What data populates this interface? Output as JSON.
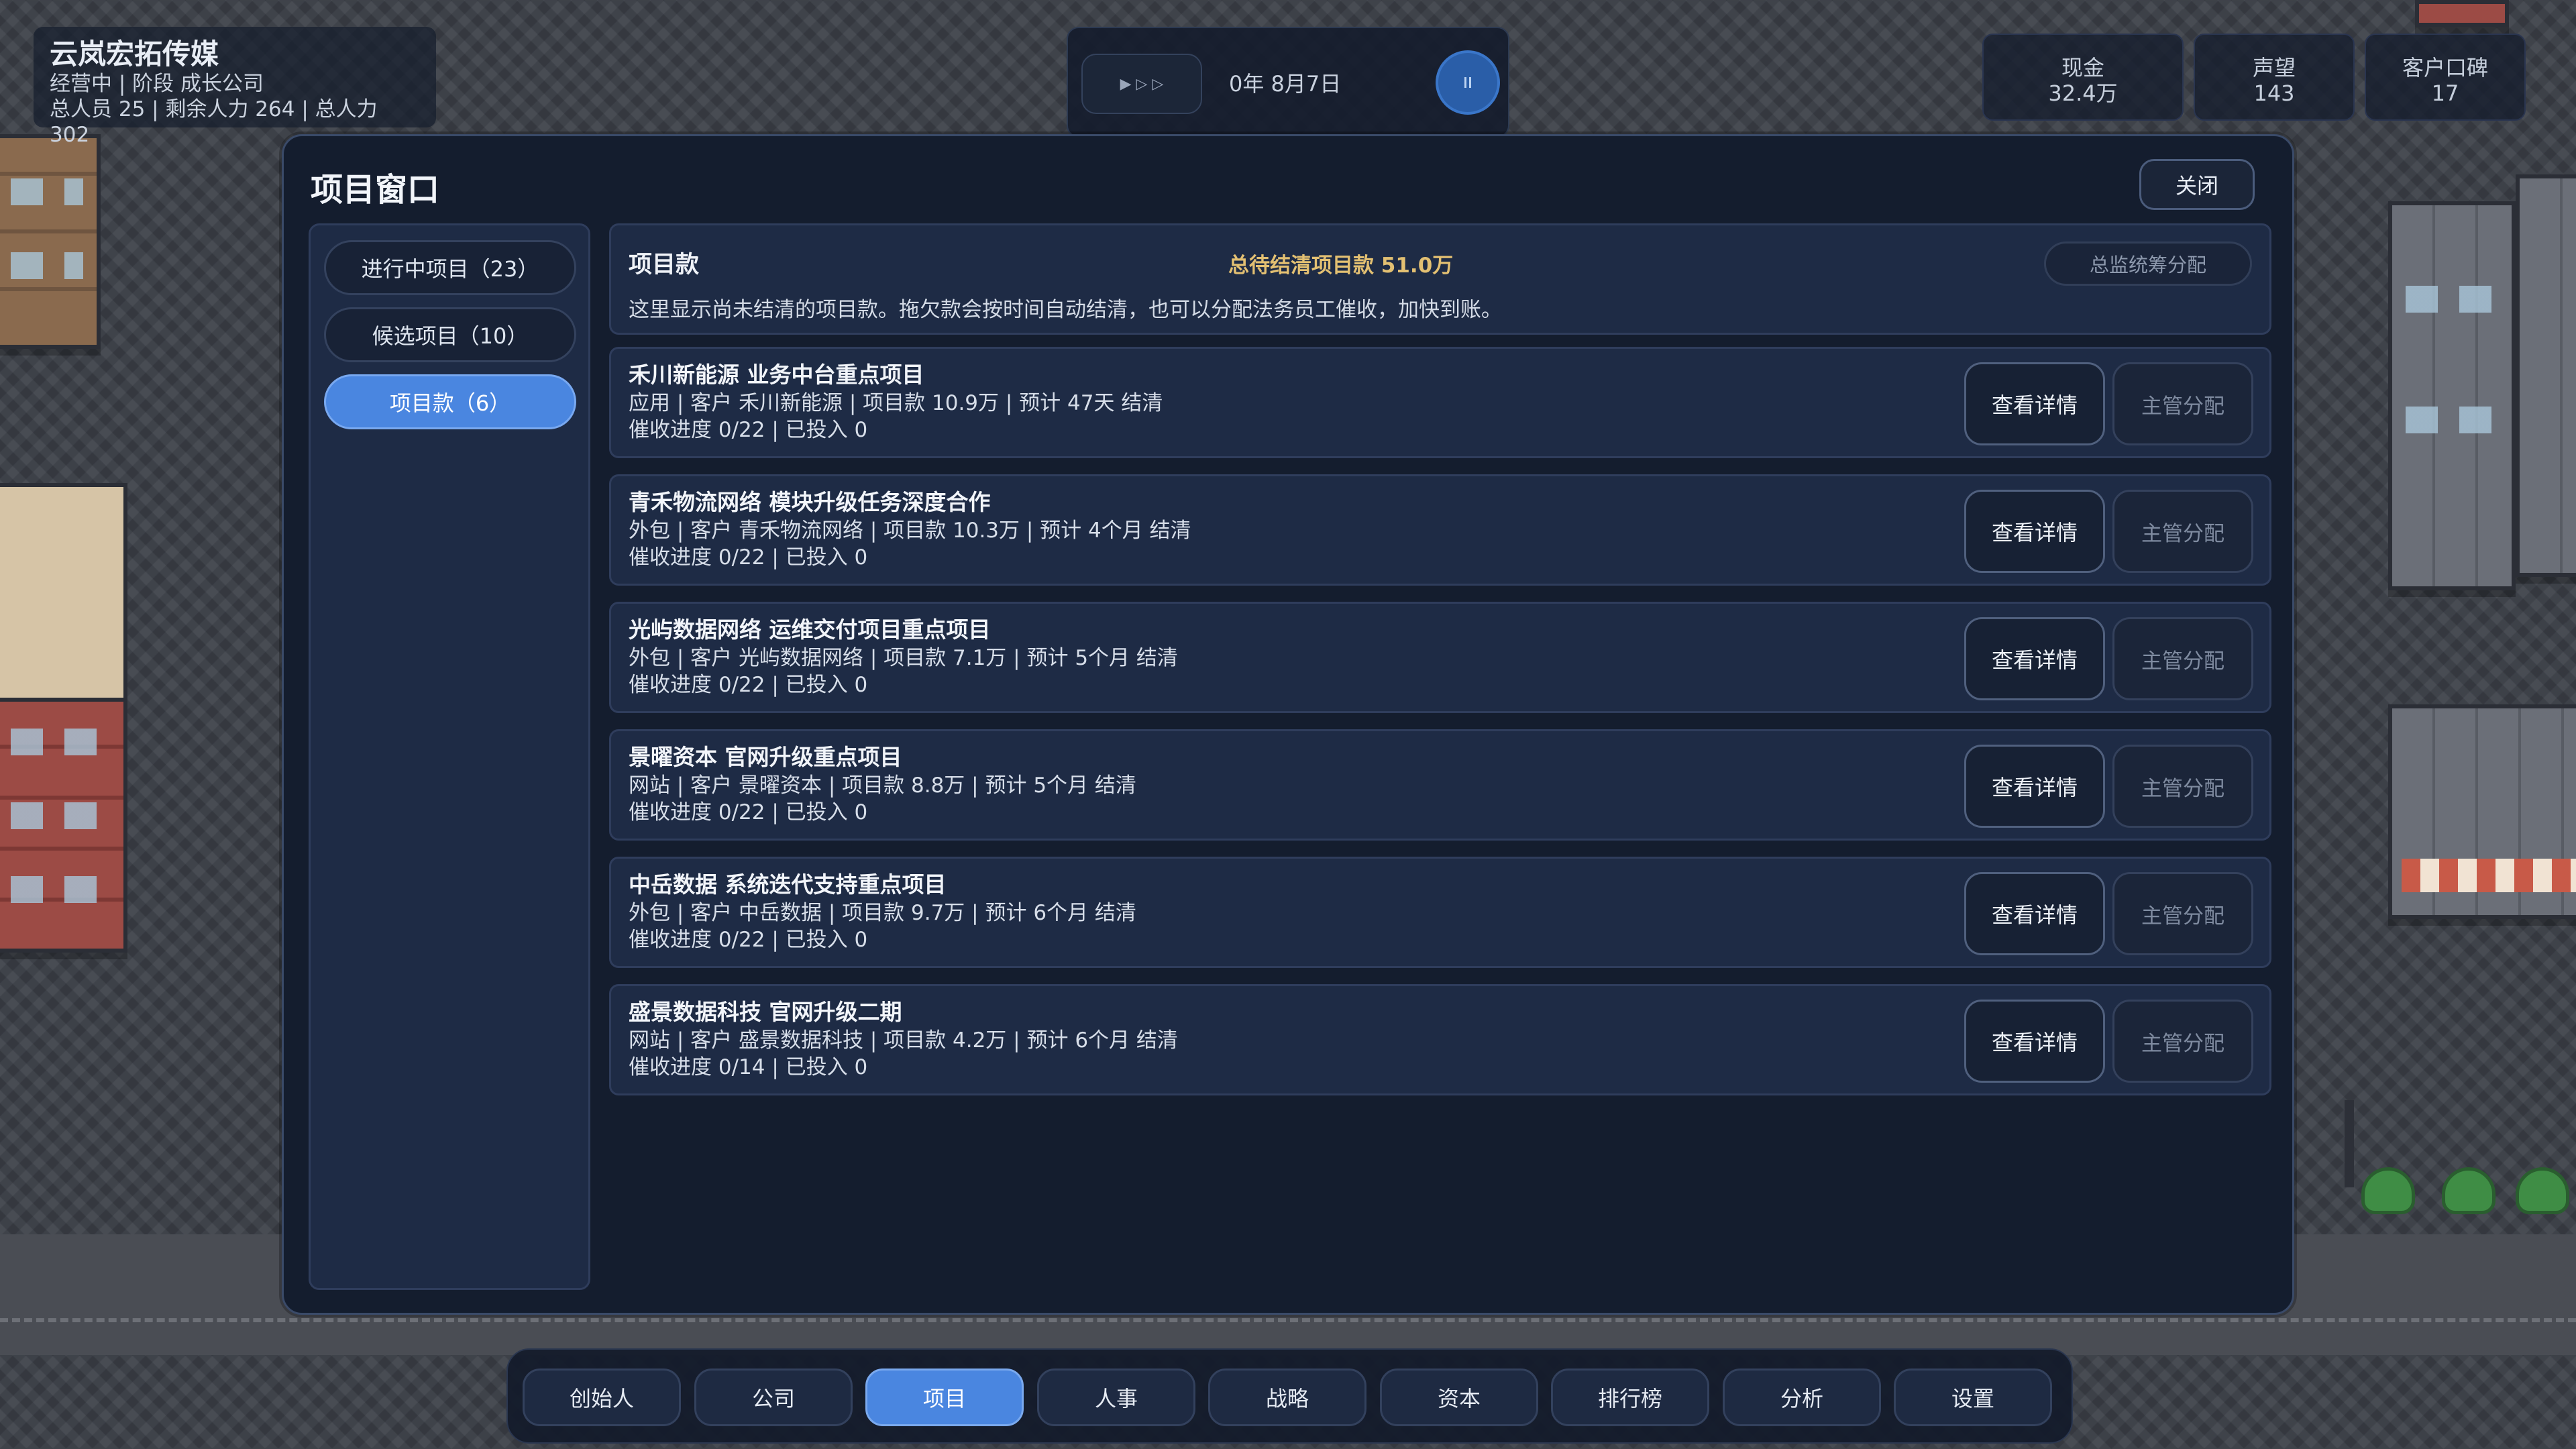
{
  "hud": {
    "company_name": "云岚宏拓传媒",
    "status_line": "经营中 | 阶段 成长公司",
    "staff_line": "总人员 25 | 剩余人力 264 | 总人力 302",
    "speed_icon": "▶ ▷ ▷",
    "date": "0年 8月7日",
    "stats": [
      {
        "label": "现金",
        "value": "32.4万"
      },
      {
        "label": "声望",
        "value": "143"
      },
      {
        "label": "客户口碑",
        "value": "17"
      }
    ]
  },
  "window": {
    "title": "项目窗口",
    "close_label": "关闭",
    "tabs": [
      {
        "label": "进行中项目（23）"
      },
      {
        "label": "候选项目（10）"
      },
      {
        "label": "项目款（6）"
      }
    ],
    "active_tab": 2,
    "summary": {
      "title": "项目款",
      "total": "总待结清项目款 51.0万",
      "description": "这里显示尚未结清的项目款。拖欠款会按时间自动结清，也可以分配法务员工催收，加快到账。",
      "assign_all_label": "总监统筹分配"
    },
    "projects": [
      {
        "title": "禾川新能源 业务中台重点项目",
        "meta": "应用 | 客户 禾川新能源 | 项目款 10.9万 | 预计 47天 结清",
        "progress": "催收进度 0/22 | 已投入 0",
        "detail_label": "查看详情",
        "assign_label": "主管分配"
      },
      {
        "title": "青禾物流网络 模块升级任务深度合作",
        "meta": "外包 | 客户 青禾物流网络 | 项目款 10.3万 | 预计 4个月 结清",
        "progress": "催收进度 0/22 | 已投入 0",
        "detail_label": "查看详情",
        "assign_label": "主管分配"
      },
      {
        "title": "光屿数据网络 运维交付项目重点项目",
        "meta": "外包 | 客户 光屿数据网络 | 项目款 7.1万 | 预计 5个月 结清",
        "progress": "催收进度 0/22 | 已投入 0",
        "detail_label": "查看详情",
        "assign_label": "主管分配"
      },
      {
        "title": "景曜资本 官网升级重点项目",
        "meta": "网站 | 客户 景曜资本 | 项目款 8.8万 | 预计 5个月 结清",
        "progress": "催收进度 0/22 | 已投入 0",
        "detail_label": "查看详情",
        "assign_label": "主管分配"
      },
      {
        "title": "中岳数据 系统迭代支持重点项目",
        "meta": "外包 | 客户 中岳数据 | 项目款 9.7万 | 预计 6个月 结清",
        "progress": "催收进度 0/22 | 已投入 0",
        "detail_label": "查看详情",
        "assign_label": "主管分配"
      },
      {
        "title": "盛景数据科技 官网升级二期",
        "meta": "网站 | 客户 盛景数据科技 | 项目款 4.2万 | 预计 6个月 结清",
        "progress": "催收进度 0/14 | 已投入 0",
        "detail_label": "查看详情",
        "assign_label": "主管分配"
      }
    ]
  },
  "bottom_nav": {
    "items": [
      "创始人",
      "公司",
      "项目",
      "人事",
      "战略",
      "资本",
      "排行榜",
      "分析",
      "设置"
    ],
    "active_index": 2
  },
  "colors": {
    "accent": "#4a86e0",
    "panel": "#1e2b45",
    "window_bg": "#141d2e",
    "gold_text": "#e3c072"
  }
}
